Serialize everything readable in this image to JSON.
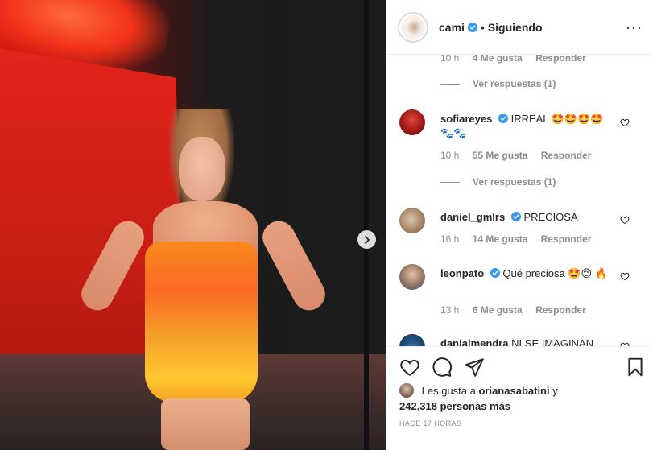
{
  "header": {
    "username": "cami",
    "separator": "•",
    "follow_status": "Siguiendo",
    "more": "···"
  },
  "comments": {
    "top_meta": {
      "time": "10 h",
      "likes": "4 Me gusta",
      "reply": "Responder"
    },
    "top_view_replies": "Ver respuestas (1)",
    "items": [
      {
        "username": "sofiareyes",
        "text": "IRREAL 🤩🤩🤩🤩 🐾🐾",
        "time": "10 h",
        "likes": "55 Me gusta",
        "reply": "Responder",
        "view_replies": "Ver respuestas (1)"
      },
      {
        "username": "daniel_gmlrs",
        "text": "PRECIOSA",
        "time": "16 h",
        "likes": "14 Me gusta",
        "reply": "Responder"
      },
      {
        "username": "leonpato",
        "text": "Qué preciosa 🤩😌 🔥",
        "time": "13 h",
        "likes": "6 Me gusta",
        "reply": "Responder"
      },
      {
        "username": "danialmendra",
        "text": "NI SE IMAGINAN"
      }
    ]
  },
  "likes": {
    "prefix": "Les gusta a",
    "user": "orianasabatini",
    "joiner": "y",
    "count": "242,318 personas más"
  },
  "timestamp": "HACE 17 HORAS",
  "icons": {
    "verified": "verified-badge-icon",
    "like": "heart-icon",
    "comment": "comment-icon",
    "share": "paper-plane-icon",
    "save": "bookmark-icon",
    "next": "chevron-right-icon"
  },
  "colors": {
    "verified": "#3897f0",
    "text": "#262626",
    "muted": "#8e8e8e",
    "border": "#efefef"
  }
}
